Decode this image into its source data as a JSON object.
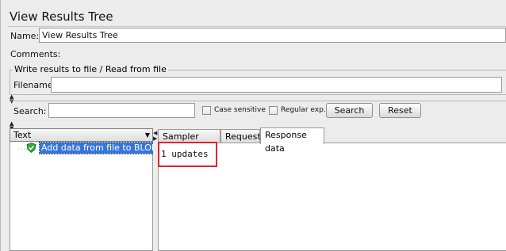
{
  "window": {
    "title": "View Results Tree"
  },
  "form": {
    "name_label": "Name:",
    "name_value": "View Results Tree",
    "comments_label": "Comments:"
  },
  "file_group": {
    "legend": "Write results to file / Read from file",
    "filename_label": "Filename",
    "filename_value": ""
  },
  "search": {
    "label": "Search:",
    "value": "",
    "case_sensitive_label": "Case sensitive",
    "case_sensitive_checked": false,
    "regex_label": "Regular exp.",
    "regex_checked": false,
    "search_button": "Search",
    "reset_button": "Reset"
  },
  "tree": {
    "renderer_selected": "Text",
    "items": [
      {
        "label": "Add data from file to BLOB",
        "status": "success",
        "icon": "check-shield-icon",
        "selected": true
      }
    ]
  },
  "result_tabs": [
    {
      "label": "Sampler result",
      "active": false
    },
    {
      "label": "Request",
      "active": false
    },
    {
      "label": "Response data",
      "active": true
    }
  ],
  "response": {
    "text": "1 updates"
  },
  "colors": {
    "selection": "#3875d7",
    "success": "#2fa838",
    "annotation": "#e0242c"
  }
}
